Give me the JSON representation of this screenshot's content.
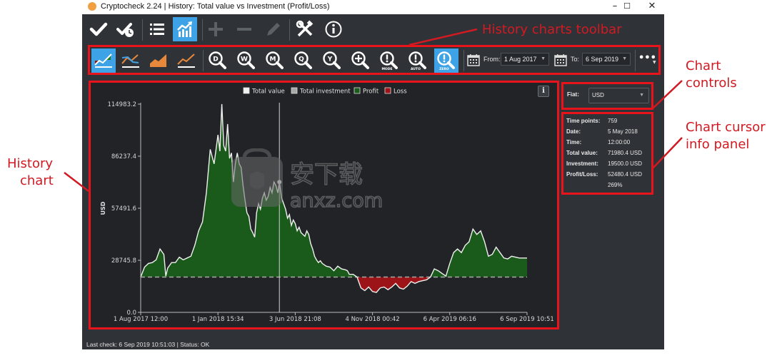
{
  "window": {
    "title": "Cryptocheck 2.24  |  History: Total value vs Investment (Profit/Loss)",
    "controls": {
      "minimize": "–",
      "maximize": "☐",
      "close": "✕"
    }
  },
  "main_toolbar": {
    "buttons": [
      {
        "name": "check",
        "icon": "checkmark-icon",
        "active": false,
        "enabled": true
      },
      {
        "name": "check-clock",
        "icon": "check-clock-icon",
        "active": false,
        "enabled": true
      },
      {
        "name": "list",
        "icon": "list-icon",
        "active": false,
        "enabled": true
      },
      {
        "name": "history-chart",
        "icon": "chart-icon",
        "active": true,
        "enabled": true
      },
      {
        "name": "add",
        "icon": "plus-icon",
        "active": false,
        "enabled": false
      },
      {
        "name": "remove",
        "icon": "minus-icon",
        "active": false,
        "enabled": false
      },
      {
        "name": "edit",
        "icon": "pencil-icon",
        "active": false,
        "enabled": false
      },
      {
        "name": "tools",
        "icon": "tools-icon",
        "active": false,
        "enabled": true
      },
      {
        "name": "info",
        "icon": "info-icon",
        "active": false,
        "enabled": true
      }
    ]
  },
  "history_toolbar": {
    "chart_modes": [
      {
        "name": "profit-loss-chart",
        "icon": "profit-loss-chart-icon",
        "active": true
      },
      {
        "name": "compare-chart",
        "icon": "compare-chart-icon",
        "active": false
      },
      {
        "name": "area-chart",
        "icon": "area-chart-icon",
        "active": false
      },
      {
        "name": "line-chart",
        "icon": "line-chart-icon",
        "active": false
      }
    ],
    "zoom_buttons": [
      {
        "name": "zoom-day",
        "letter": "D",
        "sub": "",
        "active": false
      },
      {
        "name": "zoom-week",
        "letter": "W",
        "sub": "",
        "active": false
      },
      {
        "name": "zoom-month",
        "letter": "M",
        "sub": "",
        "active": false
      },
      {
        "name": "zoom-quarter",
        "letter": "Q",
        "sub": "",
        "active": false
      },
      {
        "name": "zoom-year",
        "letter": "Y",
        "sub": "",
        "active": false
      },
      {
        "name": "zoom-in",
        "letter": "+",
        "sub": "",
        "active": false
      },
      {
        "name": "zoom-mode",
        "letter": "!",
        "sub": "MODE",
        "active": false
      },
      {
        "name": "zoom-auto",
        "letter": "!",
        "sub": "AUTO",
        "active": false
      },
      {
        "name": "zoom-zero",
        "letter": "!",
        "sub": "ZERO",
        "active": true
      }
    ],
    "from_label": "From:",
    "from_value": "1 Aug 2017",
    "to_label": "To:",
    "to_value": "6 Sep 2019",
    "more_label": "•••"
  },
  "chart_controls": {
    "fiat_label": "Fiat:",
    "fiat_value": "USD"
  },
  "cursor_info": {
    "rows": [
      {
        "key": "Time points:",
        "value": "759"
      },
      {
        "key": "Date:",
        "value": "5 May 2018"
      },
      {
        "key": "Time:",
        "value": "12:00:00"
      },
      {
        "key": "Total value:",
        "value": "71980.4 USD"
      },
      {
        "key": "Investment:",
        "value": "19500.0 USD"
      },
      {
        "key": "Profit/Loss:",
        "value": "52480.4 USD"
      },
      {
        "key": "",
        "value": "269%"
      }
    ]
  },
  "status_bar": {
    "text": "Last check: 6 Sep 2019 10:51:03  |  Status: OK"
  },
  "chart_info_button": "i",
  "annotations": {
    "history_charts_toolbar": "History charts toolbar",
    "chart_controls_1": "Chart",
    "chart_controls_2": "controls",
    "cursor_info_1": "Chart cursor",
    "cursor_info_2": "info panel",
    "history_chart_1": "History",
    "history_chart_2": "chart"
  },
  "watermark": {
    "text_cn": "安下载",
    "text_en": "anxz.com"
  },
  "colors": {
    "accent": "#3ea2e6",
    "profit": "#1a5a1a",
    "loss": "#9c1418",
    "annotation": "#d11a22",
    "background": "#2f3337",
    "chart_bg": "#212326"
  },
  "chart_data": {
    "type": "area",
    "title": "",
    "ylabel": "USD",
    "xlabel": "",
    "ylim": [
      0,
      114983.2
    ],
    "yticks": [
      0.0,
      28745.8,
      57491.6,
      86237.4,
      114983.2
    ],
    "ytick_labels": [
      "0.0",
      "28745.8",
      "57491.6",
      "86237.4",
      "114983.2"
    ],
    "xtick_labels": [
      "1 Aug 2017 12:00",
      "1 Jan 2018 15:34",
      "3 Jun 2018 21:08",
      "4 Nov 2018 00:42",
      "6 Apr 2019 06:16",
      "6 Sep 2019 10:51"
    ],
    "legend": [
      {
        "label": "Total value",
        "color": "#f0f0f0"
      },
      {
        "label": "Total investment",
        "color": "#a8a8a8"
      },
      {
        "label": "Profit",
        "color": "#1a5a1a"
      },
      {
        "label": "Loss",
        "color": "#9c1418"
      }
    ],
    "legend_position": "top-center",
    "investment": 19500.0,
    "cursor": {
      "x_fraction": 0.359,
      "value": 71980.4,
      "date": "5 May 2018"
    },
    "series": [
      {
        "name": "Total value",
        "x_fraction": [
          0.0,
          0.01,
          0.02,
          0.03,
          0.04,
          0.05,
          0.06,
          0.065,
          0.07,
          0.075,
          0.08,
          0.09,
          0.1,
          0.11,
          0.12,
          0.13,
          0.14,
          0.15,
          0.16,
          0.17,
          0.18,
          0.19,
          0.2,
          0.205,
          0.21,
          0.215,
          0.22,
          0.225,
          0.23,
          0.235,
          0.24,
          0.245,
          0.25,
          0.255,
          0.26,
          0.265,
          0.27,
          0.275,
          0.28,
          0.285,
          0.29,
          0.295,
          0.3,
          0.305,
          0.31,
          0.315,
          0.32,
          0.325,
          0.33,
          0.335,
          0.34,
          0.345,
          0.35,
          0.355,
          0.359,
          0.365,
          0.37,
          0.375,
          0.38,
          0.385,
          0.39,
          0.395,
          0.4,
          0.405,
          0.41,
          0.415,
          0.42,
          0.425,
          0.43,
          0.435,
          0.44,
          0.445,
          0.45,
          0.455,
          0.46,
          0.465,
          0.47,
          0.48,
          0.49,
          0.5,
          0.51,
          0.52,
          0.53,
          0.535,
          0.54,
          0.55,
          0.56,
          0.57,
          0.58,
          0.59,
          0.6,
          0.61,
          0.62,
          0.63,
          0.64,
          0.65,
          0.66,
          0.67,
          0.68,
          0.69,
          0.7,
          0.71,
          0.72,
          0.73,
          0.74,
          0.75,
          0.76,
          0.77,
          0.78,
          0.79,
          0.8,
          0.81,
          0.82,
          0.83,
          0.84,
          0.85,
          0.86,
          0.87,
          0.88,
          0.89,
          0.9,
          0.91,
          0.92,
          0.93,
          0.94,
          0.95,
          0.96,
          0.97,
          0.98,
          0.99,
          1.0
        ],
        "values": [
          19500,
          25000,
          27000,
          27500,
          29000,
          35000,
          32000,
          20000,
          24500,
          26000,
          27500,
          27500,
          30500,
          29000,
          30000,
          31000,
          37000,
          45000,
          50000,
          66000,
          90000,
          82000,
          98000,
          89000,
          115000,
          92000,
          89000,
          104000,
          85000,
          88000,
          72000,
          82000,
          88000,
          82000,
          80000,
          70000,
          62000,
          55000,
          53000,
          46000,
          44000,
          41500,
          55000,
          60000,
          57000,
          63000,
          66000,
          62000,
          64000,
          69000,
          66000,
          72000,
          70000,
          66000,
          71980,
          63000,
          60000,
          57000,
          52000,
          54000,
          48000,
          51000,
          49000,
          45000,
          47000,
          44000,
          43000,
          42000,
          45000,
          43000,
          38000,
          35000,
          31000,
          29000,
          27500,
          28500,
          27000,
          25500,
          25000,
          23000,
          25500,
          24000,
          23500,
          23000,
          21000,
          21000,
          19500,
          13500,
          12000,
          14000,
          11500,
          11000,
          13500,
          14000,
          12500,
          14000,
          16000,
          13500,
          12800,
          14500,
          17000,
          16000,
          17000,
          17500,
          18000,
          19500,
          24000,
          23000,
          21500,
          20000,
          27000,
          33000,
          35000,
          33000,
          37000,
          39000,
          46000,
          43000,
          45000,
          39000,
          31000,
          32000,
          36000,
          33000,
          30000,
          29500,
          31000,
          30500,
          30000,
          30000,
          30000
        ]
      }
    ]
  }
}
